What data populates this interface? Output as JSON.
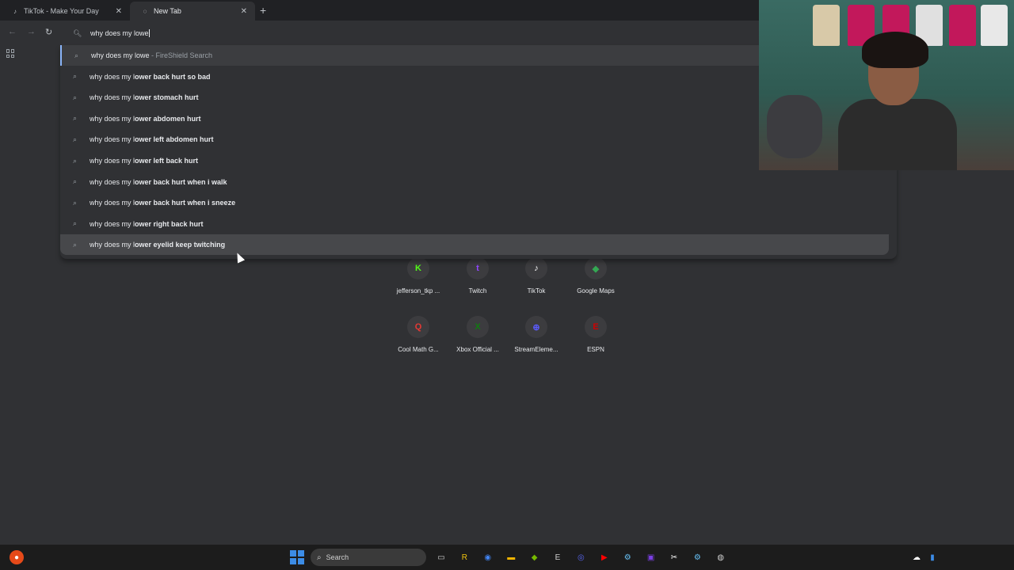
{
  "tabs": [
    {
      "title": "TikTok - Make Your Day",
      "icon": "tiktok-icon"
    },
    {
      "title": "New Tab",
      "icon": "globe-icon"
    }
  ],
  "omnibox": {
    "value": "why does my lowe"
  },
  "suggestions": [
    {
      "prefix": "why does my lowe",
      "suffix": "",
      "hint": " - FireShield Search",
      "selected": true
    },
    {
      "prefix": "why does my l",
      "suffix": "ower back hurt so bad",
      "hint": ""
    },
    {
      "prefix": "why does my l",
      "suffix": "ower stomach hurt",
      "hint": ""
    },
    {
      "prefix": "why does my l",
      "suffix": "ower abdomen hurt",
      "hint": ""
    },
    {
      "prefix": "why does my l",
      "suffix": "ower left abdomen hurt",
      "hint": ""
    },
    {
      "prefix": "why does my l",
      "suffix": "ower left back hurt",
      "hint": ""
    },
    {
      "prefix": "why does my l",
      "suffix": "ower back hurt when i walk",
      "hint": ""
    },
    {
      "prefix": "why does my l",
      "suffix": "ower back hurt when i sneeze",
      "hint": ""
    },
    {
      "prefix": "why does my l",
      "suffix": "ower right back hurt",
      "hint": ""
    },
    {
      "prefix": "why does my l",
      "suffix": "ower eyelid keep twitching",
      "hint": "",
      "hover": true
    }
  ],
  "shortcuts": [
    {
      "label": "jefferson_tkp ...",
      "glyph": "K",
      "color": "#53fc18",
      "icon": "kick-icon"
    },
    {
      "label": "Twitch",
      "glyph": "t",
      "color": "#9146ff",
      "icon": "twitch-icon"
    },
    {
      "label": "TikTok",
      "glyph": "♪",
      "color": "#ffffff",
      "icon": "tiktok-icon"
    },
    {
      "label": "Google Maps",
      "glyph": "◆",
      "color": "#34a853",
      "icon": "maps-icon"
    },
    {
      "label": "Cool Math G...",
      "glyph": "Q",
      "color": "#e53935",
      "icon": "coolmath-icon"
    },
    {
      "label": "Xbox Official ...",
      "glyph": "X",
      "color": "#107c10",
      "icon": "xbox-icon"
    },
    {
      "label": "StreamEleme...",
      "glyph": "⊕",
      "color": "#5b5bff",
      "icon": "streamelements-icon"
    },
    {
      "label": "ESPN",
      "glyph": "E",
      "color": "#d00000",
      "icon": "espn-icon"
    }
  ],
  "taskbar": {
    "search_placeholder": "Search",
    "apps": [
      "file-icon",
      "roblox-icon",
      "chrome-icon",
      "folder-icon",
      "nvidia-icon",
      "epic-icon",
      "discord-icon",
      "youtube-icon",
      "steam-icon",
      "clip-icon",
      "capcut-icon",
      "steam-icon",
      "obs-icon"
    ]
  },
  "colors": {
    "accent": "#8ab4f8",
    "background": "#303134"
  }
}
